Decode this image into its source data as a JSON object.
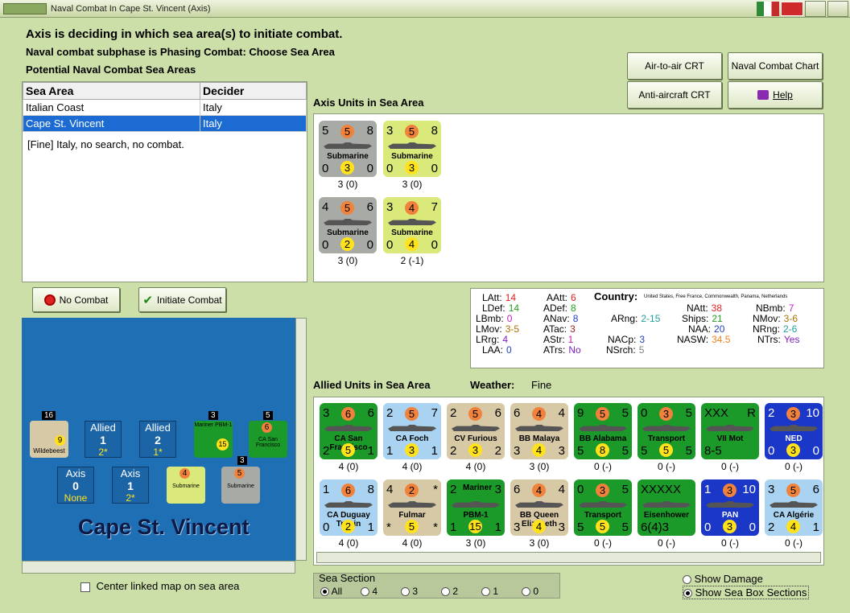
{
  "window": {
    "title": "Naval Combat In Cape St. Vincent (Axis)"
  },
  "header": {
    "line1": "Axis is deciding in which sea area(s) to initiate combat.",
    "line2": "Naval combat subphase is Phasing Combat: Choose Sea Area",
    "line3": "Potential Naval Combat Sea Areas"
  },
  "buttons": {
    "air_crt": "Air-to-air CRT",
    "naval_chart": "Naval Combat Chart",
    "aa_crt": "Anti-aircraft CRT",
    "help": "Help",
    "no_combat": "No Combat",
    "initiate": "Initiate Combat"
  },
  "sea_table": {
    "headers": [
      "Sea Area",
      "Decider"
    ],
    "rows": [
      {
        "area": "Italian Coast",
        "decider": "Italy"
      },
      {
        "area": "Cape St. Vincent",
        "decider": "Italy"
      }
    ],
    "note": "[Fine]  Italy, no search, no combat."
  },
  "axis_units": {
    "title": "Axis Units in Sea Area",
    "units": [
      {
        "tl": "5",
        "tc": "5",
        "tr": "8",
        "name": "Submarine",
        "bl": "0",
        "bc": "3",
        "br": "0",
        "cap": "3 (0)",
        "style": "gray"
      },
      {
        "tl": "3",
        "tc": "5",
        "tr": "8",
        "name": "Submarine",
        "bl": "0",
        "bc": "3",
        "br": "0",
        "cap": "3 (0)",
        "style": "yel"
      },
      {
        "tl": "4",
        "tc": "5",
        "tr": "6",
        "name": "Submarine",
        "bl": "0",
        "bc": "2",
        "br": "0",
        "cap": "3 (0)",
        "style": "gray"
      },
      {
        "tl": "3",
        "tc": "4",
        "tr": "7",
        "name": "Submarine",
        "bl": "0",
        "bc": "4",
        "br": "0",
        "cap": "2 (-1)",
        "style": "yel"
      }
    ]
  },
  "stats": {
    "country_label": "Country:",
    "country_value": "United States, Free France, Commonwealth, Panama, Netherlands",
    "items": [
      {
        "k": "LAtt:",
        "v": "14",
        "c": "#e02020"
      },
      {
        "k": "LDef:",
        "v": "14",
        "c": "#20a020"
      },
      {
        "k": "LBmb:",
        "v": "0",
        "c": "#c020c0"
      },
      {
        "k": "LMov:",
        "v": "3-5",
        "c": "#b07000"
      },
      {
        "k": "LRrg:",
        "v": "4",
        "c": "#8020c0"
      },
      {
        "k": "LAA:",
        "v": "0",
        "c": "#2040c0"
      },
      {
        "k": "AAtt:",
        "v": "6",
        "c": "#e02020"
      },
      {
        "k": "ADef:",
        "v": "8",
        "c": "#20a020"
      },
      {
        "k": "ANav:",
        "v": "8",
        "c": "#2040c0"
      },
      {
        "k": "ATac:",
        "v": "3",
        "c": "#a02020"
      },
      {
        "k": "AStr:",
        "v": "1",
        "c": "#c020c0"
      },
      {
        "k": "ATrs:",
        "v": "No",
        "c": "#8020c0"
      },
      {
        "k": "ARng:",
        "v": "2-15",
        "c": "#20a0a0"
      },
      {
        "k": "NACp:",
        "v": "3",
        "c": "#2040c0"
      },
      {
        "k": "NSrch:",
        "v": "5",
        "c": "#808080"
      },
      {
        "k": "NAtt:",
        "v": "38",
        "c": "#e02020"
      },
      {
        "k": "Ships:",
        "v": "21",
        "c": "#20a020"
      },
      {
        "k": "NAA:",
        "v": "20",
        "c": "#2040c0"
      },
      {
        "k": "NASW:",
        "v": "34.5",
        "c": "#f08020"
      },
      {
        "k": "NBmb:",
        "v": "7",
        "c": "#c020c0"
      },
      {
        "k": "NMov:",
        "v": "3-6",
        "c": "#b07000"
      },
      {
        "k": "NRng:",
        "v": "2-6",
        "c": "#20a0a0"
      },
      {
        "k": "NTrs:",
        "v": "Yes",
        "c": "#8020c0"
      }
    ]
  },
  "allied": {
    "title": "Allied Units in Sea Area",
    "weather_label": "Weather:",
    "weather_value": "Fine",
    "row1": [
      {
        "tl": "3",
        "tc": "6",
        "tr": "6",
        "name": "CA San Francisco",
        "bl": "2",
        "bc": "5",
        "br": "1",
        "cap": "4 (0)",
        "style": "grn"
      },
      {
        "tl": "2",
        "tc": "5",
        "tr": "7",
        "name": "CA Foch",
        "bl": "1",
        "bc": "3",
        "br": "1",
        "cap": "4 (0)",
        "style": "lblue"
      },
      {
        "tl": "2",
        "tc": "5",
        "tr": "6",
        "name": "CV Furious",
        "bl": "2",
        "bc": "3",
        "br": "2",
        "cap": "4 (0)",
        "style": "tan"
      },
      {
        "tl": "6",
        "tc": "4",
        "tr": "4",
        "name": "BB Malaya",
        "bl": "3",
        "bc": "4",
        "br": "3",
        "cap": "3 (0)",
        "style": "tan"
      },
      {
        "tl": "9",
        "tc": "5",
        "tr": "5",
        "name": "BB Alabama",
        "bl": "5",
        "bc": "8",
        "br": "5",
        "cap": "0 (-)",
        "style": "grn"
      },
      {
        "tl": "0",
        "tc": "3",
        "tr": "5",
        "name": "Transport",
        "bl": "5",
        "bc": "5",
        "br": "5",
        "cap": "0 (-)",
        "style": "grn"
      },
      {
        "tl": "XXX",
        "tc": "",
        "tr": "R",
        "name": "VII Mot",
        "bl": "8-5",
        "bc": "",
        "br": "",
        "cap": "0 (-)",
        "style": "grn"
      },
      {
        "tl": "2",
        "tc": "3",
        "tr": "10",
        "name": "NED",
        "bl": "0",
        "bc": "3",
        "br": "0",
        "cap": "0 (-)",
        "style": "blue"
      }
    ],
    "row2": [
      {
        "tl": "1",
        "tc": "6",
        "tr": "8",
        "name": "CA Duguay Trouin",
        "bl": "0",
        "bc": "2",
        "br": "1",
        "cap": "4 (0)",
        "style": "lblue"
      },
      {
        "tl": "4",
        "tc": "2",
        "tr": "*",
        "name": "Fulmar",
        "bl": "*",
        "bc": "5",
        "br": "*",
        "cap": "4 (0)",
        "style": "tan"
      },
      {
        "tl": "2",
        "tc": "Mariner",
        "tr": "3",
        "name": "PBM-1",
        "bl": "1",
        "bc": "15",
        "br": "1",
        "cap": "3 (0)",
        "style": "grn"
      },
      {
        "tl": "6",
        "tc": "4",
        "tr": "4",
        "name": "BB Queen Elizabeth",
        "bl": "3",
        "bc": "4",
        "br": "3",
        "cap": "3 (0)",
        "style": "tan"
      },
      {
        "tl": "0",
        "tc": "3",
        "tr": "5",
        "name": "Transport",
        "bl": "5",
        "bc": "5",
        "br": "5",
        "cap": "0 (-)",
        "style": "grn"
      },
      {
        "tl": "XXXXX",
        "tc": "",
        "tr": "",
        "name": "Eisenhower",
        "bl": "6(4)3",
        "bc": "",
        "br": "",
        "cap": "0 (-)",
        "style": "grn"
      },
      {
        "tl": "1",
        "tc": "3",
        "tr": "10",
        "name": "PAN",
        "bl": "0",
        "bc": "3",
        "br": "0",
        "cap": "0 (-)",
        "style": "blue"
      },
      {
        "tl": "3",
        "tc": "5",
        "tr": "6",
        "name": "CA Algérie",
        "bl": "2",
        "bc": "4",
        "br": "1",
        "cap": "0 (-)",
        "style": "lblue"
      }
    ]
  },
  "map": {
    "sea_name": "Cape St. Vincent",
    "boxes": [
      {
        "label": "Allied",
        "value": "1",
        "sub": "2*"
      },
      {
        "label": "Allied",
        "value": "2",
        "sub": "1*"
      },
      {
        "label": "Axis",
        "value": "0",
        "sub": "None"
      },
      {
        "label": "Axis",
        "value": "1",
        "sub": "2*"
      }
    ],
    "stack_counts": [
      "16",
      "3",
      "5",
      "3"
    ],
    "mini": [
      {
        "t": "Wildebeest",
        "n": "9"
      },
      {
        "t": "Mariner PBM-1",
        "n": "15"
      },
      {
        "t": "CA San Francisco",
        "n": "6"
      },
      {
        "t": "Submarine",
        "n": "4"
      },
      {
        "t": "Submarine",
        "n": "5"
      }
    ]
  },
  "center_map": "Center linked map on sea area",
  "sea_section": {
    "title": "Sea Section",
    "options": [
      "All",
      "4",
      "3",
      "2",
      "1",
      "0"
    ],
    "selected": "All"
  },
  "display_opts": {
    "damage": "Show Damage",
    "boxes": "Show Sea Box Sections",
    "selected": "boxes"
  }
}
